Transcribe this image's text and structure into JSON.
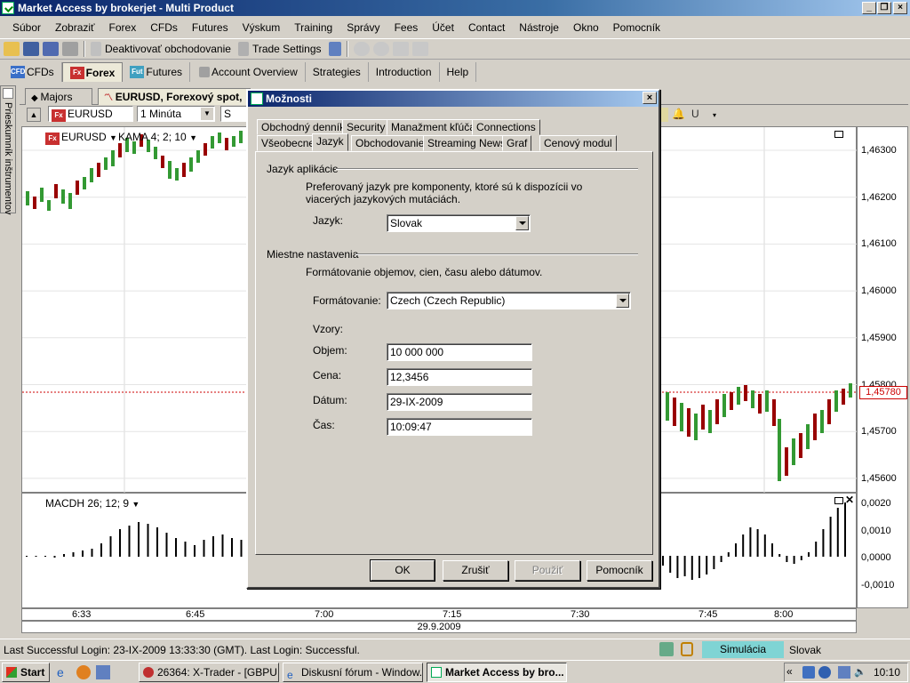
{
  "window": {
    "title": "Market Access by brokerjet - Multi Product"
  },
  "menu": [
    "Súbor",
    "Zobraziť",
    "Forex",
    "CFDs",
    "Futures",
    "Výskum",
    "Training",
    "Správy",
    "Fees",
    "Účet",
    "Contact",
    "Nástroje",
    "Okno",
    "Pomocník"
  ],
  "toolbar": {
    "deactivate_label": "Deaktivovať obchodovanie",
    "trade_settings_label": "Trade Settings"
  },
  "modules": [
    {
      "label": "CFDs",
      "badge": "CFD"
    },
    {
      "label": "Forex",
      "badge": "Fx"
    },
    {
      "label": "Futures",
      "badge": "Fut"
    },
    {
      "label": "Account Overview"
    },
    {
      "label": "Strategies"
    },
    {
      "label": "Introduction"
    },
    {
      "label": "Help"
    }
  ],
  "sidepanel": {
    "label": "Prieskumník inštrumentov"
  },
  "doc_tabs": [
    "Majors",
    "EURUSD, Forexový spot,"
  ],
  "chart_toolbar": {
    "symbol": "EURUSD",
    "interval": "1 Minúta",
    "partial": "S"
  },
  "chart": {
    "instrument": "EURUSD",
    "indicator": "KAMA 4; 2; 10",
    "macd_label": "MACDH 26; 12; 9",
    "y_ticks": [
      "1,46300",
      "1,46200",
      "1,46100",
      "1,46000",
      "1,45900",
      "1,45800",
      "1,45700",
      "1,45600"
    ],
    "current_price": "1,45780",
    "macd_ticks": [
      "0,0020",
      "0,0010",
      "0,0000",
      "-0,0010"
    ],
    "x_ticks": [
      "6:33",
      "6:45",
      "7:00",
      "7:15",
      "7:30",
      "7:45",
      "8:00"
    ],
    "date": "29.9.2009",
    "colors": {
      "up": "#339933",
      "down": "#990000",
      "price_line": "#cc0000"
    }
  },
  "status": {
    "message": "Last Successful Login: 23-IX-2009 13:33:30 (GMT). Last Login: Successful.",
    "mode": "Simulácia",
    "language": "Slovak"
  },
  "taskbar": {
    "start": "Start",
    "tasks": [
      "26364: X-Trader - [GBPU...",
      "Diskusní fórum - Window...",
      "Market Access by bro..."
    ],
    "clock": "10:10"
  },
  "dialog": {
    "title": "Možnosti",
    "tabs_row1": [
      "Obchodný denník",
      "Security",
      "Manažment kľúča",
      "Connections"
    ],
    "tabs_row2": [
      "Všeobecne",
      "Jazyk",
      "Obchodovanie",
      "Streaming News",
      "Graf",
      "Cenový modul"
    ],
    "active_tab": "Jazyk",
    "app_lang_section": "Jazyk aplikácie",
    "app_lang_desc": "Preferovaný jazyk pre komponenty, ktoré sú k dispozícii vo viacerých jazykových mutáciách.",
    "lang_label": "Jazyk:",
    "lang_value": "Slovak",
    "locale_section": "Miestne nastavenia",
    "locale_desc": "Formátovanie objemov, cien, času alebo dátumov.",
    "format_label": "Formátovanie:",
    "format_value": "Czech (Czech Republic)",
    "samples_label": "Vzory:",
    "volume_label": "Objem:",
    "volume_value": "10 000 000",
    "price_label": "Cena:",
    "price_value": "12,3456",
    "date_label": "Dátum:",
    "date_value": "29-IX-2009",
    "time_label": "Čas:",
    "time_value": "10:09:47",
    "ok": "OK",
    "cancel": "Zrušiť",
    "apply": "Použiť",
    "help": "Pomocník"
  }
}
